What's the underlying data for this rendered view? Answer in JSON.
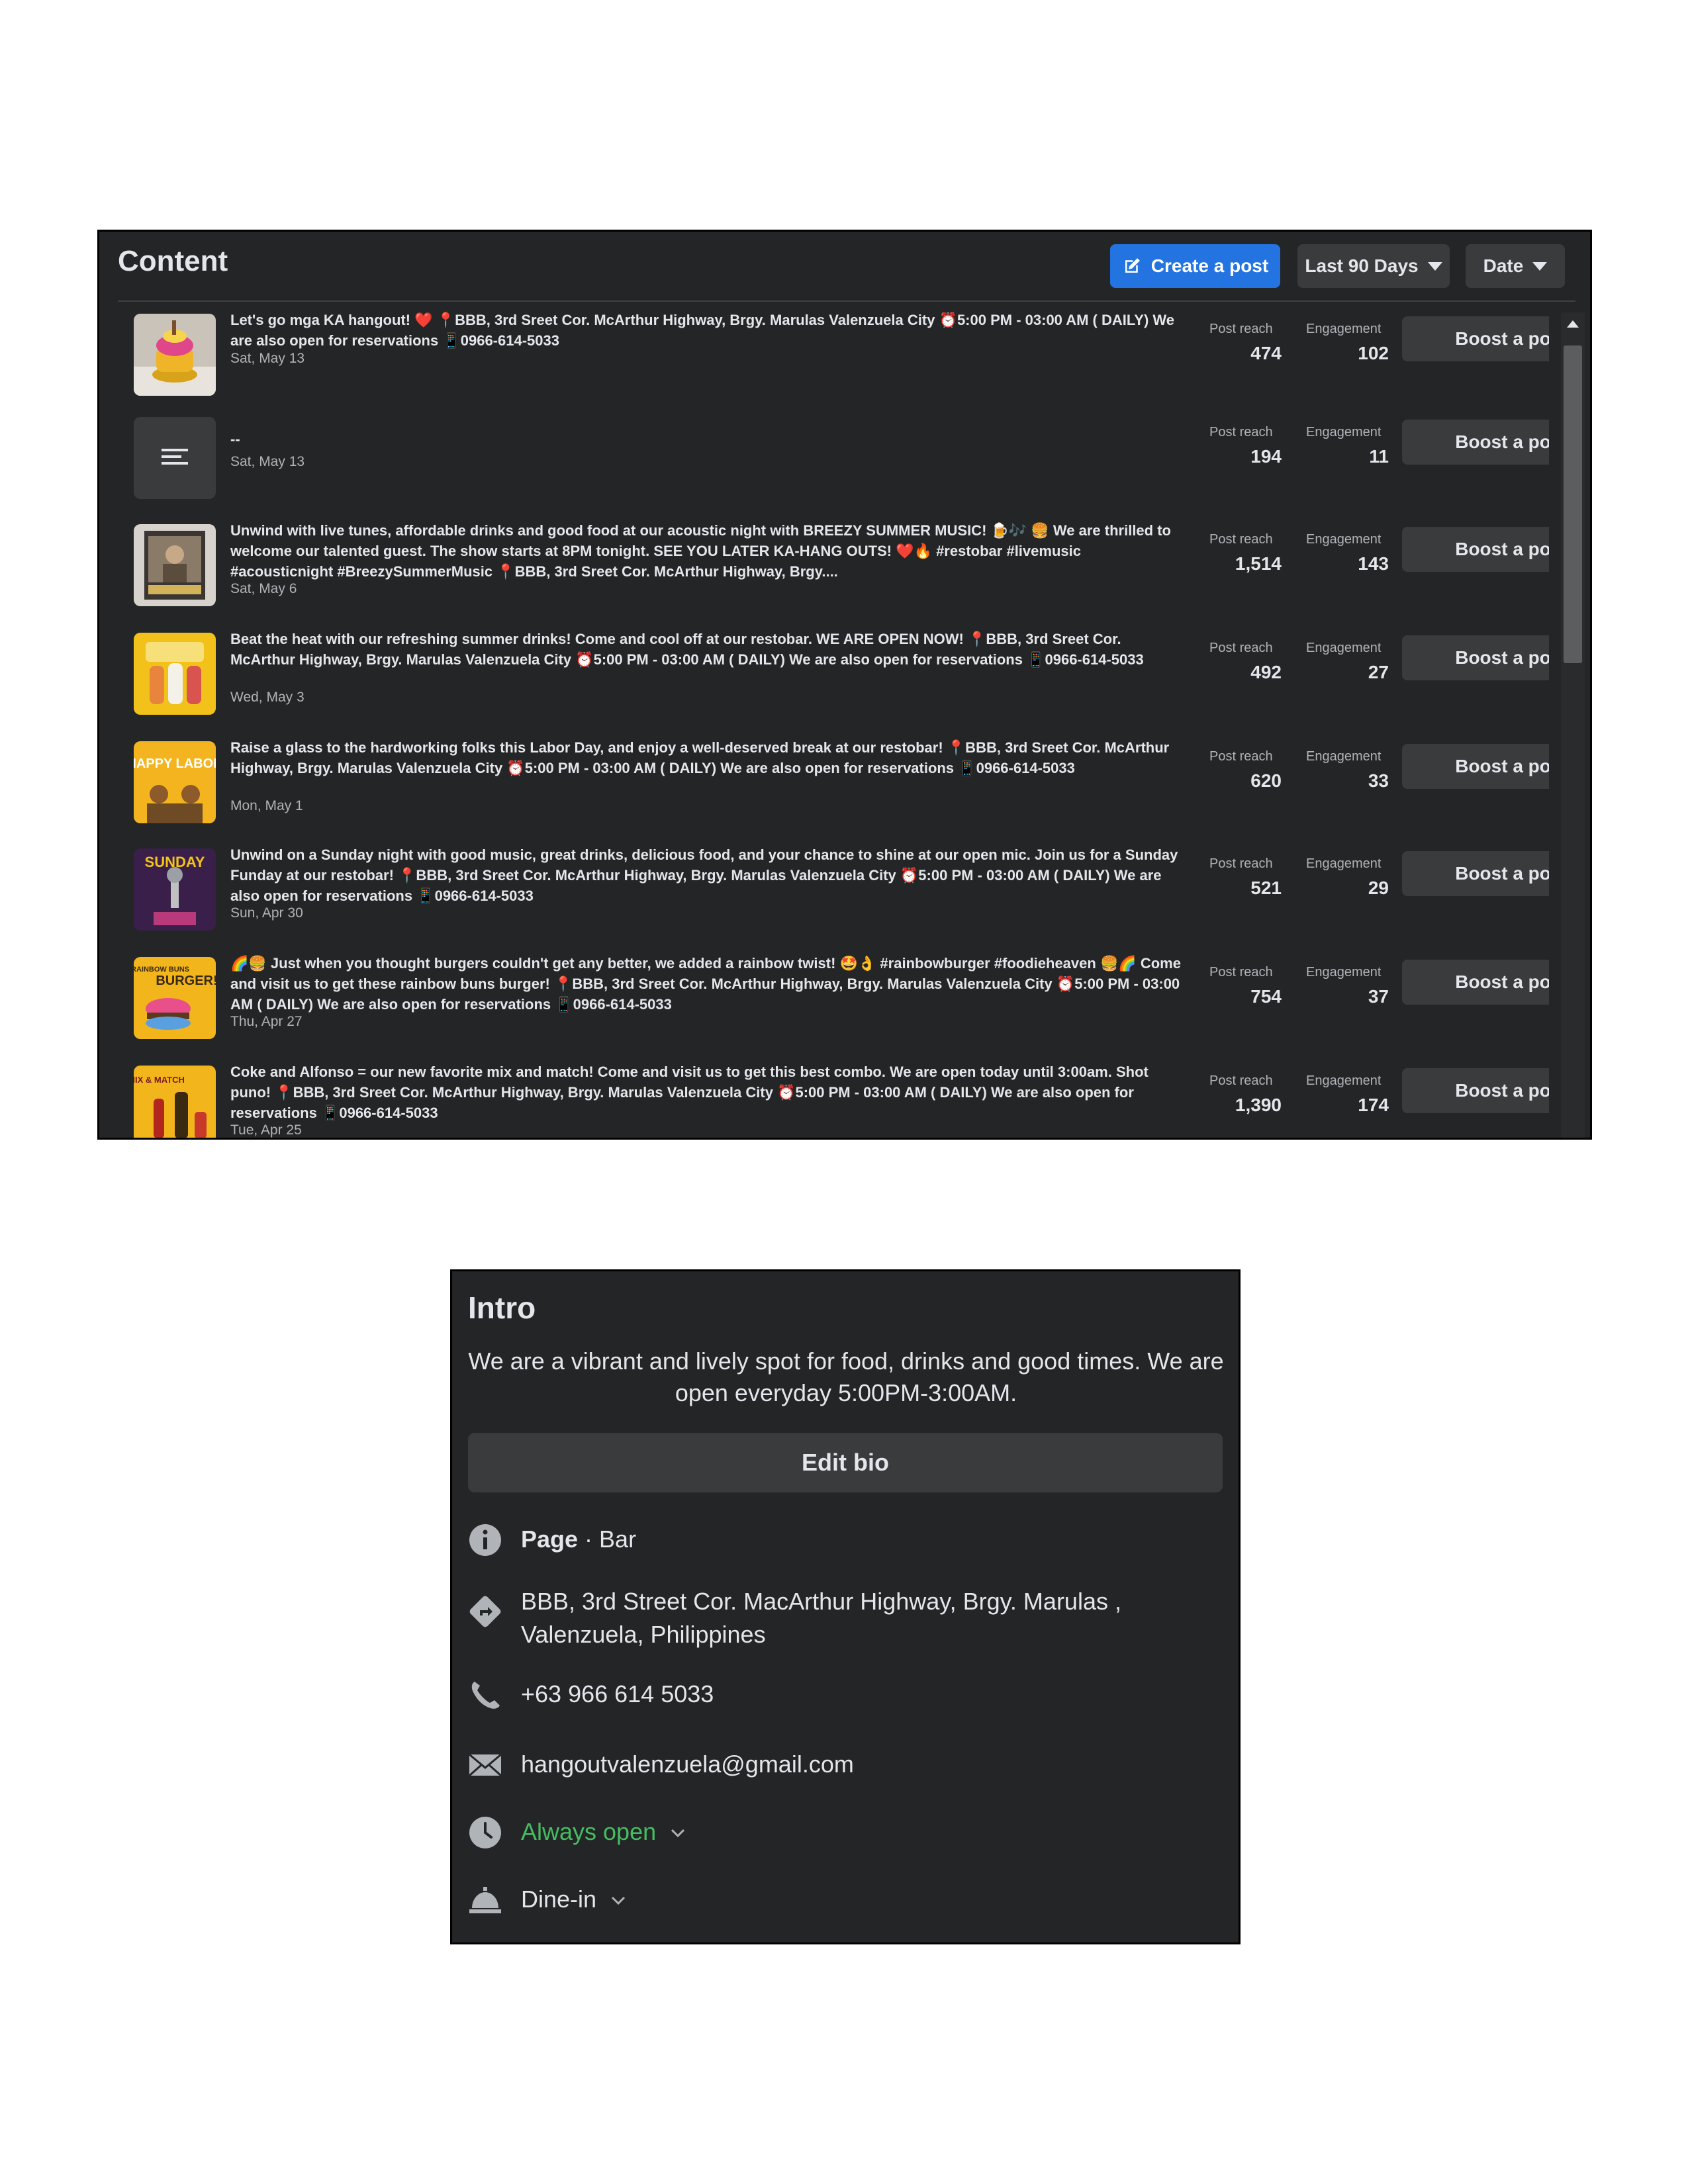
{
  "content": {
    "title": "Content",
    "create_post_label": "Create a post",
    "range_label": "Last 90 Days",
    "sort_label": "Date",
    "reach_label": "Post reach",
    "engagement_label": "Engagement",
    "boost_label": "Boost a post",
    "posts": [
      {
        "text": "Let's go mga KA hangout! ❤️ 📍BBB, 3rd Sreet Cor. McArthur Highway, Brgy. Marulas Valenzuela City ⏰5:00 PM - 03:00 AM ( DAILY) We are also open for reservations 📱0966-614-5033",
        "date": "Sat, May 13",
        "reach": "474",
        "engagement": "102"
      },
      {
        "text": "--",
        "date": "Sat, May 13",
        "reach": "194",
        "engagement": "11"
      },
      {
        "text": "Unwind with live tunes, affordable drinks and good food at our acoustic night with BREEZY SUMMER MUSIC! 🍺🎶 🍔 We are thrilled to welcome our talented guest. The show starts at 8PM tonight. SEE YOU LATER KA-HANG OUTS! ❤️🔥 #restobar #livemusic #acousticnight #BreezySummerMusic 📍BBB, 3rd Sreet Cor. McArthur Highway, Brgy....",
        "date": "Sat, May 6",
        "reach": "1,514",
        "engagement": "143"
      },
      {
        "text": "Beat the heat with our refreshing summer drinks! Come and cool off at our restobar. WE ARE OPEN NOW! 📍BBB, 3rd Sreet Cor. McArthur Highway, Brgy. Marulas Valenzuela City ⏰5:00 PM - 03:00 AM ( DAILY) We are also open for reservations 📱0966-614-5033",
        "date": "Wed, May 3",
        "reach": "492",
        "engagement": "27"
      },
      {
        "text": "Raise a glass to the hardworking folks this Labor Day, and enjoy a well-deserved break at our restobar! 📍BBB, 3rd Sreet Cor. McArthur Highway, Brgy. Marulas Valenzuela City ⏰5:00 PM - 03:00 AM ( DAILY) We are also open for reservations 📱0966-614-5033",
        "date": "Mon, May 1",
        "reach": "620",
        "engagement": "33"
      },
      {
        "text": "Unwind on a Sunday night with good music, great drinks, delicious food, and your chance to shine at our open mic. Join us for a Sunday Funday at our restobar! 📍BBB, 3rd Sreet Cor. McArthur Highway, Brgy. Marulas Valenzuela City ⏰5:00 PM - 03:00 AM ( DAILY) We are also open for reservations 📱0966-614-5033",
        "date": "Sun, Apr 30",
        "reach": "521",
        "engagement": "29"
      },
      {
        "text": "🌈🍔 Just when you thought burgers couldn't get any better, we added a rainbow twist! 🤩👌 #rainbowburger #foodieheaven 🍔🌈 Come and visit us to get these rainbow buns burger! 📍BBB, 3rd Sreet Cor. McArthur Highway, Brgy. Marulas Valenzuela City ⏰5:00 PM - 03:00 AM ( DAILY) We are also open for reservations 📱0966-614-5033",
        "date": "Thu, Apr 27",
        "reach": "754",
        "engagement": "37"
      },
      {
        "text": "Coke and Alfonso = our new favorite mix and match! Come and visit us to get this best combo. We are open today until 3:00am. Shot puno! 📍BBB, 3rd Sreet Cor. McArthur Highway, Brgy. Marulas Valenzuela City ⏰5:00 PM - 03:00 AM ( DAILY) We are also open for reservations 📱0966-614-5033",
        "date": "Tue, Apr 25",
        "reach": "1,390",
        "engagement": "174"
      }
    ],
    "thumb_texts": {
      "labor": "HAPPY LABOR",
      "sunday": "SUNDAY",
      "burger_top": "RAINBOW BUNS",
      "burger": "BURGER!",
      "mix": "MIX & MATCH"
    }
  },
  "intro": {
    "title": "Intro",
    "bio": "We are a vibrant and lively spot for food, drinks and good times. We are open everyday 5:00PM-3:00AM.",
    "edit_bio_label": "Edit bio",
    "category_prefix": "Page",
    "category_sep": " · ",
    "category": "Bar",
    "address": "BBB, 3rd Street Cor. MacArthur Highway, Brgy. Marulas , Valenzuela, Philippines",
    "phone": "+63 966 614 5033",
    "email": "hangoutvalenzuela@gmail.com",
    "hours": "Always open",
    "service": "Dine-in"
  },
  "colors": {
    "panel_bg": "#242526",
    "button_bg": "#3a3b3c",
    "accent": "#2374e1",
    "open_green": "#45bd62",
    "secondary_text": "#b0b3b8"
  },
  "icons": [
    "edit-icon",
    "caret-down-icon",
    "text-post-icon",
    "info-icon",
    "directions-icon",
    "phone-icon",
    "email-icon",
    "clock-icon",
    "bell-service-icon",
    "chevron-down-icon"
  ]
}
